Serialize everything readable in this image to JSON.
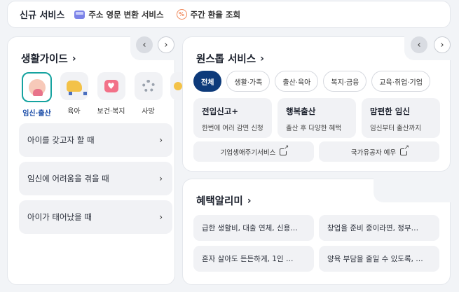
{
  "topbar": {
    "title": "신규 서비스",
    "services": [
      {
        "label": "주소 영문 변환 서비스",
        "icon": "envelope-icon"
      },
      {
        "label": "주간 환율 조회",
        "icon": "exchange-rate-icon"
      }
    ]
  },
  "life_guide": {
    "title": "생활가이드",
    "nav": {
      "prev": "‹",
      "next": "›"
    },
    "categories": [
      {
        "label": "임신·출산",
        "icon": "pregnancy-icon",
        "active": true
      },
      {
        "label": "육아",
        "icon": "stroller-icon"
      },
      {
        "label": "보건·복지",
        "icon": "health-heart-icon"
      },
      {
        "label": "사망",
        "icon": "flower-icon"
      },
      {
        "label": "",
        "icon": "partial-category-icon"
      }
    ],
    "questions": [
      {
        "label": "아이를 갖고자 할 때"
      },
      {
        "label": "임신에 어려움을 겪을 때"
      },
      {
        "label": "아이가 태어났을 때"
      }
    ]
  },
  "one_stop": {
    "title": "원스톱 서비스",
    "nav": {
      "prev": "‹",
      "next": "›"
    },
    "filters": [
      {
        "label": "전체",
        "active": true
      },
      {
        "label": "생활·가족"
      },
      {
        "label": "출산·육아"
      },
      {
        "label": "복지·금융"
      },
      {
        "label": "교육·취업·기업"
      }
    ],
    "features": [
      {
        "title": "전입신고+",
        "desc": "한번에 여러 감면 신청"
      },
      {
        "title": "행복출산",
        "desc": "출산 후 다양한 혜택"
      },
      {
        "title": "맘편한 임신",
        "desc": "임신부터 출산까지"
      }
    ],
    "links": [
      {
        "label": "기업생애주기서비스"
      },
      {
        "label": "국가유공자 예우"
      }
    ]
  },
  "benefits": {
    "title": "혜택알리미",
    "items": [
      {
        "label": "급한 생활비, 대출 연체, 신용…"
      },
      {
        "label": "창업을 준비 중이라면, 정부…"
      },
      {
        "label": "혼자 살아도 든든하게, 1인 …"
      },
      {
        "label": "양육 부담을 줄일 수 있도록, …"
      }
    ]
  },
  "chevron": "›",
  "arrow": "›"
}
